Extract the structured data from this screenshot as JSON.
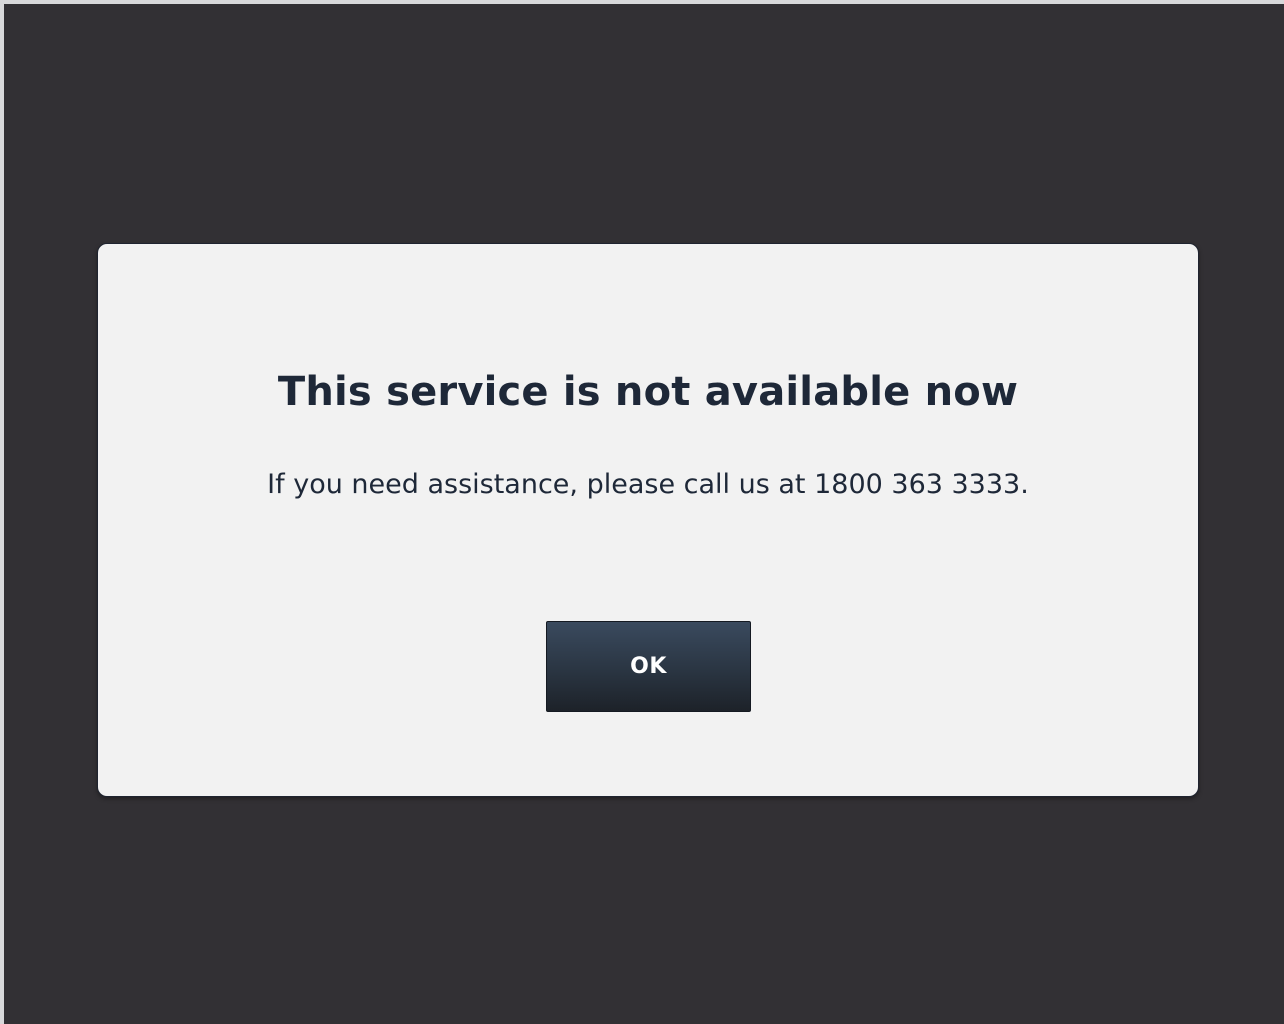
{
  "dialog": {
    "title": "This service is not available now",
    "message": "If you need assistance, please call us at 1800 363 3333.",
    "ok_label": "OK"
  },
  "colors": {
    "overlay": "#323034",
    "dialog_background": "#f2f2f2",
    "text": "#1e2838",
    "button_top": "#3a4a5e",
    "button_bottom": "#1d2229",
    "button_text": "#ffffff"
  }
}
